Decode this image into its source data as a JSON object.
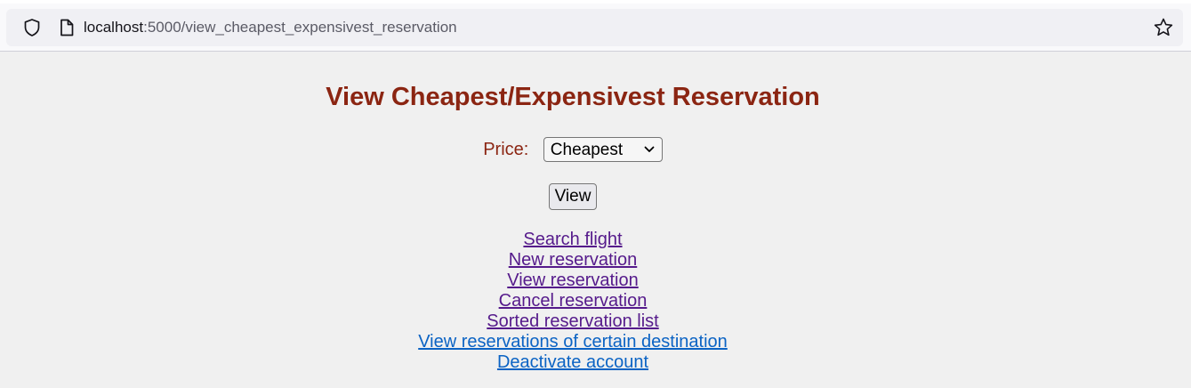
{
  "browser": {
    "url_host": "localhost",
    "url_path": ":5000/view_cheapest_expensivest_reservation"
  },
  "page": {
    "title": "View Cheapest/Expensivest Reservation",
    "price_label": "Price:",
    "price_selected": "Cheapest",
    "view_button": "View"
  },
  "links": [
    {
      "label": "Search flight",
      "state": "visited"
    },
    {
      "label": "New reservation",
      "state": "visited"
    },
    {
      "label": "View reservation",
      "state": "visited"
    },
    {
      "label": "Cancel reservation",
      "state": "visited"
    },
    {
      "label": "Sorted reservation list",
      "state": "visited"
    },
    {
      "label": "View reservations of certain destination",
      "state": "unvisited"
    },
    {
      "label": "Deactivate account",
      "state": "unvisited"
    }
  ],
  "colors": {
    "heading": "#8b2512",
    "link_visited": "#551a8b",
    "link_unvisited": "#0b63c4"
  }
}
